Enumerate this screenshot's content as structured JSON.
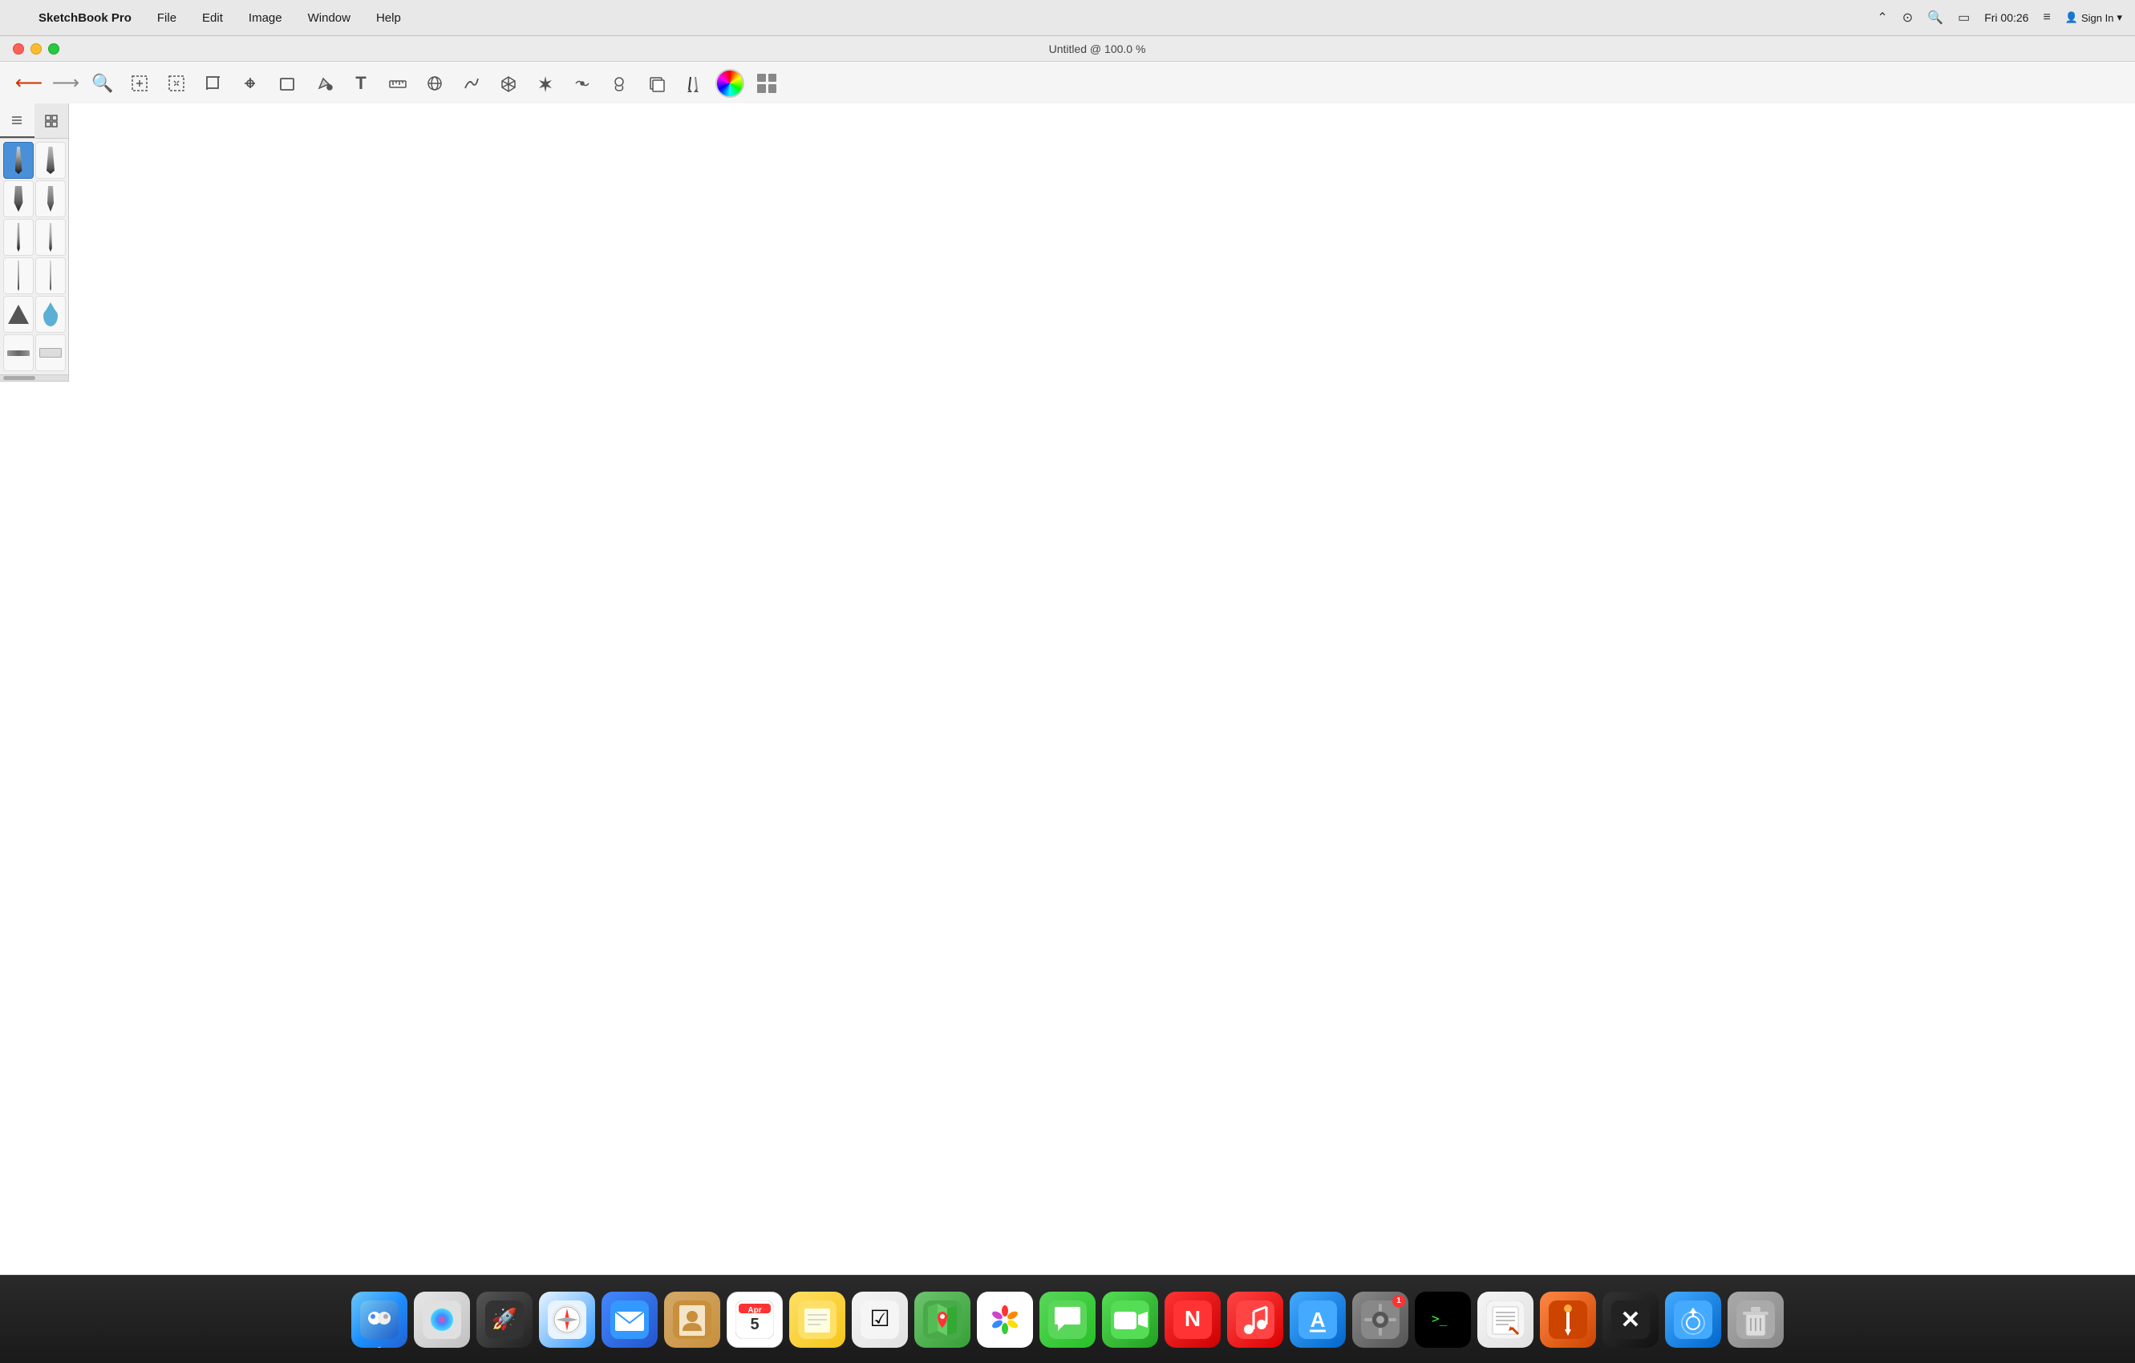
{
  "menubar": {
    "apple_label": "",
    "app_name": "SketchBook Pro",
    "menus": [
      "File",
      "Edit",
      "Image",
      "Window",
      "Help"
    ],
    "time": "Fri 00:26",
    "sign_in": "Sign In"
  },
  "window": {
    "title": "Untitled @ 100.0 %"
  },
  "toolbar": {
    "tools": [
      {
        "name": "undo",
        "icon": "←",
        "label": "Undo"
      },
      {
        "name": "redo",
        "icon": "→",
        "label": "Redo"
      },
      {
        "name": "zoom",
        "icon": "🔍",
        "label": "Zoom"
      },
      {
        "name": "select-rect",
        "icon": "⊹",
        "label": "Select Rectangle"
      },
      {
        "name": "select-lasso",
        "icon": "⬚",
        "label": "Select Lasso"
      },
      {
        "name": "crop",
        "icon": "⊡",
        "label": "Crop"
      },
      {
        "name": "transform",
        "icon": "⊕",
        "label": "Transform"
      },
      {
        "name": "distort",
        "icon": "⬜",
        "label": "Distort"
      },
      {
        "name": "fill",
        "icon": "⬡",
        "label": "Fill"
      },
      {
        "name": "text",
        "icon": "T",
        "label": "Text"
      },
      {
        "name": "ruler",
        "icon": "📐",
        "label": "Ruler"
      },
      {
        "name": "symmetry",
        "icon": "⊙",
        "label": "Symmetry"
      },
      {
        "name": "curve",
        "icon": "〜",
        "label": "Curve"
      },
      {
        "name": "3d",
        "icon": "⊞",
        "label": "3D"
      },
      {
        "name": "eraser",
        "icon": "✦",
        "label": "Eraser"
      },
      {
        "name": "smudge",
        "icon": "⌒",
        "label": "Smudge"
      },
      {
        "name": "stamp",
        "icon": "⊜",
        "label": "Stamp"
      },
      {
        "name": "layers",
        "icon": "⧉",
        "label": "Layers"
      },
      {
        "name": "pens",
        "icon": "✏",
        "label": "Pens"
      },
      {
        "name": "color-wheel",
        "icon": "●",
        "label": "Color Wheel"
      },
      {
        "name": "brush-library",
        "icon": "⊞",
        "label": "Brush Library"
      }
    ]
  },
  "brush_panel": {
    "tabs": [
      {
        "name": "list-view",
        "icon": "≡"
      },
      {
        "name": "grid-view",
        "icon": "⊞"
      }
    ],
    "brushes": [
      {
        "name": "pencil-hard",
        "selected": true
      },
      {
        "name": "pencil-soft",
        "selected": false
      },
      {
        "name": "marker-wide",
        "selected": false
      },
      {
        "name": "marker-thin",
        "selected": false
      },
      {
        "name": "pen-round",
        "selected": false
      },
      {
        "name": "pen-flat",
        "selected": false
      },
      {
        "name": "fine-liner",
        "selected": false
      },
      {
        "name": "fine-pen",
        "selected": false
      },
      {
        "name": "triangle-brush",
        "selected": false
      },
      {
        "name": "water-drop",
        "selected": false
      },
      {
        "name": "flat-brush-1",
        "selected": false
      },
      {
        "name": "flat-brush-2",
        "selected": false
      }
    ]
  },
  "dock": {
    "items": [
      {
        "name": "finder",
        "label": "Finder",
        "icon": "🔍",
        "has_dot": true
      },
      {
        "name": "siri",
        "label": "Siri",
        "icon": "🎙",
        "has_dot": false
      },
      {
        "name": "launchpad",
        "label": "Launchpad",
        "icon": "🚀",
        "has_dot": false
      },
      {
        "name": "safari",
        "label": "Safari",
        "icon": "🧭",
        "has_dot": false
      },
      {
        "name": "mail",
        "label": "Mail",
        "icon": "✉",
        "has_dot": false
      },
      {
        "name": "contacts",
        "label": "Contacts",
        "icon": "📒",
        "has_dot": false
      },
      {
        "name": "calendar",
        "label": "Calendar",
        "icon": "📅",
        "has_dot": false
      },
      {
        "name": "notes",
        "label": "Notes",
        "icon": "📝",
        "has_dot": false
      },
      {
        "name": "reminders",
        "label": "Reminders",
        "icon": "☑",
        "has_dot": false
      },
      {
        "name": "maps",
        "label": "Maps",
        "icon": "🗺",
        "has_dot": false
      },
      {
        "name": "photos",
        "label": "Photos",
        "icon": "🌸",
        "has_dot": false
      },
      {
        "name": "messages",
        "label": "Messages",
        "icon": "💬",
        "has_dot": false
      },
      {
        "name": "facetime",
        "label": "FaceTime",
        "icon": "📹",
        "has_dot": false
      },
      {
        "name": "news",
        "label": "News",
        "icon": "📰",
        "has_dot": false
      },
      {
        "name": "music",
        "label": "Music",
        "icon": "🎵",
        "has_dot": false
      },
      {
        "name": "appstore",
        "label": "App Store",
        "icon": "A",
        "has_dot": false
      },
      {
        "name": "systemprefs",
        "label": "System Preferences",
        "icon": "⚙",
        "has_dot": false
      },
      {
        "name": "terminal",
        "label": "Terminal",
        "icon": ">_",
        "has_dot": false
      },
      {
        "name": "textedit",
        "label": "TextEdit",
        "icon": "📄",
        "has_dot": false
      },
      {
        "name": "sketch-pen",
        "label": "Sketch Pen",
        "icon": "✏",
        "has_dot": false
      },
      {
        "name": "sketch-x",
        "label": "Sketch X",
        "icon": "✖",
        "has_dot": false
      },
      {
        "name": "airdrop",
        "label": "AirDrop",
        "icon": "↗",
        "has_dot": false
      },
      {
        "name": "trash",
        "label": "Trash",
        "icon": "🗑",
        "has_dot": false
      }
    ],
    "calendar_date": "5",
    "calendar_month": "Apr"
  },
  "colors": {
    "menubar_bg": "#e8e8e8",
    "toolbar_bg": "#f5f5f5",
    "canvas_bg": "#ffffff",
    "brush_panel_bg": "#f0f0f0",
    "dock_bg": "#1a1a1a",
    "selected_brush_bg": "#4a90d9",
    "traffic_close": "#ff5f57",
    "traffic_min": "#febc2e",
    "traffic_max": "#28c840"
  }
}
